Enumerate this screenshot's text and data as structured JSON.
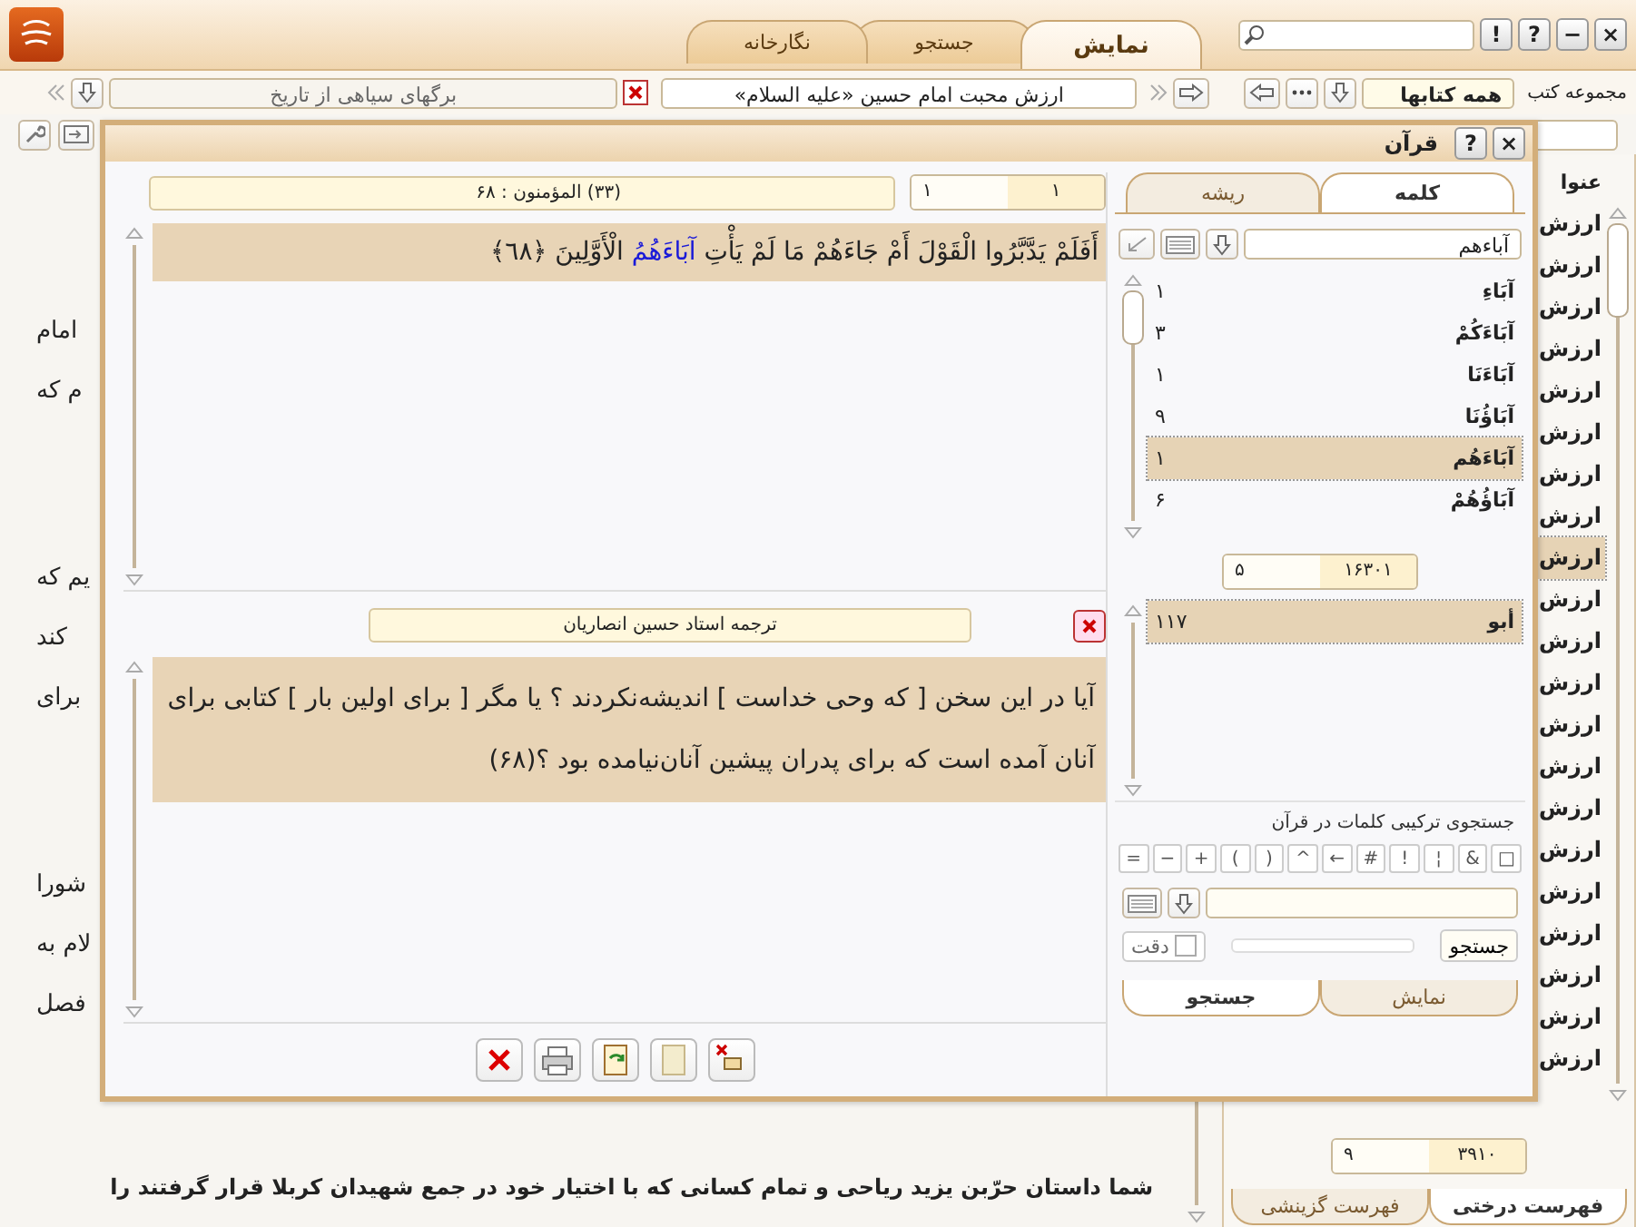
{
  "window": {
    "controls": [
      "×",
      "−",
      "?",
      "!"
    ]
  },
  "tabs": [
    {
      "label": "نمایش",
      "selected": true
    },
    {
      "label": "جستجو",
      "selected": false
    },
    {
      "label": "نگارخانه",
      "selected": false
    }
  ],
  "toolbar": {
    "collection_label": "مجموعه کتب",
    "collection": "همه کتابها",
    "current_book": "ارزش محبت امام حسین «علیه السلام»",
    "other_book": "برگهای سیاهی از تاریخ"
  },
  "reader": {
    "paragraphs": [
      [
        "امام",
        "م که"
      ],
      [
        "یم که",
        "کند",
        "برای"
      ],
      [
        "شورا",
        "لام به",
        "فصل"
      ]
    ],
    "last_line": "شما داستان حرّبن یزید ریاحی و تمام کسانی که با اختیار خود در جمع شهیدان کربلا قرار گرفتند را"
  },
  "sidebar": {
    "header": "عنوا",
    "items": [
      {
        "label": "ارزش",
        "selected": false
      },
      {
        "label": "ارزش",
        "selected": false
      },
      {
        "label": "ارزش",
        "selected": false
      },
      {
        "label": "ارزش",
        "selected": false
      },
      {
        "label": "ارزش",
        "selected": false
      },
      {
        "label": "ارزش",
        "selected": false
      },
      {
        "label": "ارزش",
        "selected": false
      },
      {
        "label": "ارزش",
        "selected": false
      },
      {
        "label": "ارزش",
        "selected": true
      },
      {
        "label": "ارزش",
        "selected": false
      },
      {
        "label": "ارزش",
        "selected": false
      },
      {
        "label": "ارزش",
        "selected": false
      },
      {
        "label": "ارزش",
        "selected": false
      },
      {
        "label": "ارزش",
        "selected": false
      },
      {
        "label": "ارزش",
        "selected": false
      },
      {
        "label": "ارزش",
        "selected": false
      },
      {
        "label": "ارزش",
        "selected": false
      },
      {
        "label": "ارزش",
        "selected": false
      },
      {
        "label": "ارزش",
        "selected": false
      },
      {
        "label": "ارزش",
        "selected": false
      },
      {
        "label": "ارزش",
        "selected": false
      }
    ],
    "pager": {
      "current": "۹",
      "total": "۳۹۱۰"
    },
    "tabs": [
      {
        "label": "فهرست درختی",
        "selected": true
      },
      {
        "label": "فهرست گزینشی",
        "selected": false
      }
    ]
  },
  "dialog": {
    "title": "قرآن",
    "controls": [
      "×",
      "?"
    ],
    "verse_pager": {
      "current": "۱",
      "total": "۱"
    },
    "verse_ref": "(۳۳) المؤمنون : ۶۸",
    "verse": {
      "before": "أَفَلَمْ يَدَّبَّرُوا الْقَوْلَ أَمْ جَاءَهُمْ مَا لَمْ يَأْتِ",
      "highlight": "آبَاءَهُمُ",
      "after": "الْأَوَّلِينَ ﴿٦٨﴾"
    },
    "translation_title": "ترجمه استاد حسین انصاریان",
    "translation": "آیا در این سخن [ که وحی خداست ] اندیشه‌نکردند ؟ یا مگر [ برای اولین بار ] کتابی برای آنان آمده است که برای پدران پیشین آنان‌نیامده بود ؟(۶۸)",
    "word_tabs": [
      {
        "label": "کلمه",
        "selected": true
      },
      {
        "label": "ریشه",
        "selected": false
      }
    ],
    "word_query": "آباءهم",
    "words": [
      {
        "word": "آبَاءِ",
        "count": "۱",
        "selected": false
      },
      {
        "word": "آبَاءَكُمْ",
        "count": "۳",
        "selected": false
      },
      {
        "word": "آبَاءَنَا",
        "count": "۱",
        "selected": false
      },
      {
        "word": "آبَاؤُنَا",
        "count": "۹",
        "selected": false
      },
      {
        "word": "آبَاءَهُم",
        "count": "۱",
        "selected": true
      },
      {
        "word": "آبَاؤُهُمْ",
        "count": "۶",
        "selected": false
      }
    ],
    "words_pager": {
      "current": "۵",
      "total": "۱۶۳۰۱"
    },
    "roots": [
      {
        "word": "أبو",
        "count": "۱۱۷",
        "selected": true
      }
    ],
    "combo_title": "جستجوی ترکیبی کلمات در قرآن",
    "operators": [
      "□",
      "&",
      "¦",
      "!",
      "#",
      "←",
      "^",
      ")",
      "(",
      "+",
      "−",
      "="
    ],
    "search_button": "جستجو",
    "progress": {
      "level": 0
    },
    "precision": {
      "label": "دقت",
      "checked": false
    },
    "bottom_tabs": [
      {
        "label": "نمایش",
        "selected": false
      },
      {
        "label": "جستجو",
        "selected": true
      }
    ]
  }
}
